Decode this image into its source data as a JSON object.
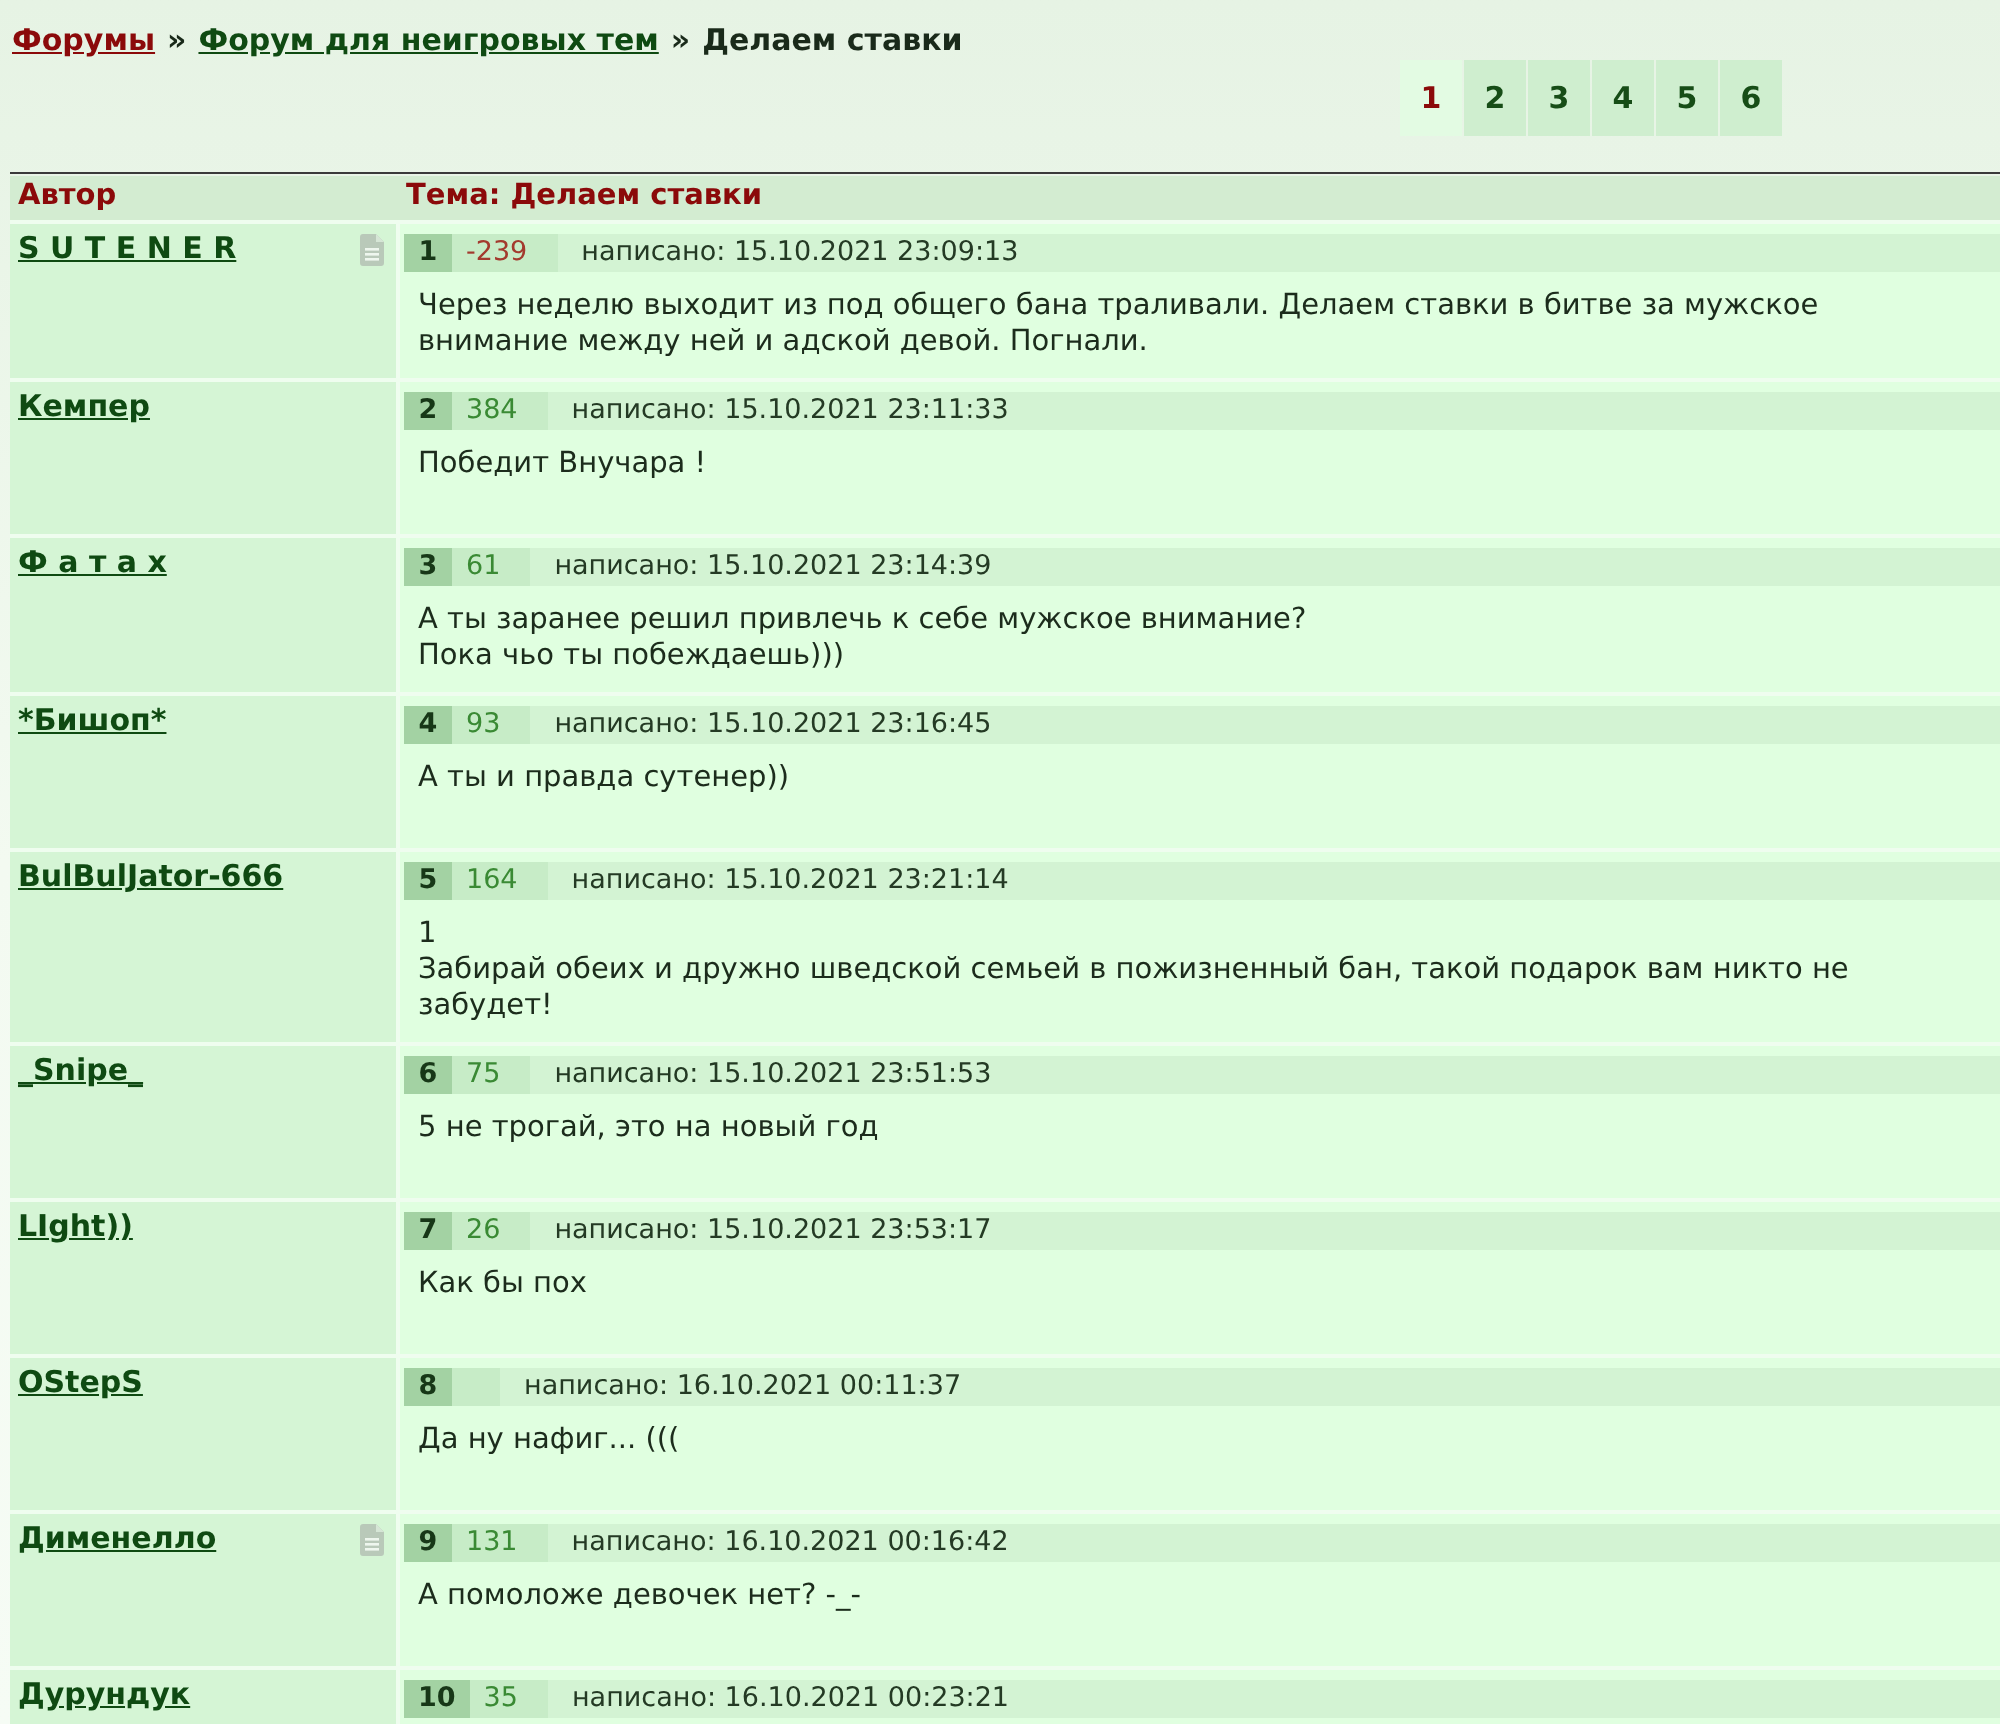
{
  "breadcrumb": [
    {
      "kind": "link",
      "label": "Форумы",
      "visited": true
    },
    {
      "kind": "separator",
      "label": "»"
    },
    {
      "kind": "link",
      "label": "Форум для неигровых тем",
      "visited": false
    },
    {
      "kind": "separator",
      "label": "»"
    },
    {
      "kind": "current",
      "label": "Делаем ставки"
    }
  ],
  "pagination": [
    {
      "label": "1",
      "selected": true
    },
    {
      "label": "2",
      "selected": false
    },
    {
      "label": "3",
      "selected": false
    },
    {
      "label": "4",
      "selected": false
    },
    {
      "label": "5",
      "selected": false
    },
    {
      "label": "6",
      "selected": false
    }
  ],
  "table": {
    "columns": [
      "Автор",
      "Тема: Делаем ставки"
    ],
    "posts": [
      {
        "author": "S U T E N E R",
        "file_icon": true,
        "number": "1",
        "rating": {
          "value": "-239",
          "color": "#a33a2e"
        },
        "date": "написано: 15.10.2021 23:09:13",
        "text": "Через неделю выходит из под общего бана траливали. Делаем ставки в битве за мужское внимание между ней и адской девой. Погнали."
      },
      {
        "author": "Кемпер",
        "file_icon": false,
        "number": "2",
        "rating": {
          "value": "384",
          "color": "#3a8a34"
        },
        "date": "написано: 15.10.2021 23:11:33",
        "text": "Победит Внучара !"
      },
      {
        "author": "Ф а т а х",
        "file_icon": false,
        "number": "3",
        "rating": {
          "value": "61",
          "color": "#3a8a34"
        },
        "date": "написано: 15.10.2021 23:14:39",
        "text": "А ты заранее решил привлечь к себе мужское внимание?\nПока чьо ты побеждаешь)))"
      },
      {
        "author": "*Бишоп*",
        "file_icon": false,
        "number": "4",
        "rating": {
          "value": "93",
          "color": "#3a8a34"
        },
        "date": "написано: 15.10.2021 23:16:45",
        "text": "А ты и правда сутенер))"
      },
      {
        "author": "BulBulJator-666",
        "file_icon": false,
        "number": "5",
        "rating": {
          "value": "164",
          "color": "#3a8a34"
        },
        "date": "написано: 15.10.2021 23:21:14",
        "text": "1\nЗабирай обеих и дружно шведской семьей в пожизненный бан, такой подарок вам никто не забудет!"
      },
      {
        "author": "_Snipe_",
        "file_icon": false,
        "number": "6",
        "rating": {
          "value": "75",
          "color": "#3a8a34"
        },
        "date": "написано: 15.10.2021 23:51:53",
        "text": "5 не трогай, это на новый год"
      },
      {
        "author": "LIght))",
        "file_icon": false,
        "number": "7",
        "rating": {
          "value": "26",
          "color": "#3a8a34"
        },
        "date": "написано: 15.10.2021 23:53:17",
        "text": "Как бы пох"
      },
      {
        "author": "OStepS",
        "file_icon": false,
        "number": "8",
        "date": "написано: 16.10.2021 00:11:37",
        "text": "Да ну нафиг... ((("
      },
      {
        "author": "Дименелло",
        "file_icon": true,
        "number": "9",
        "rating": {
          "value": "131",
          "color": "#3a8a34"
        },
        "date": "написано: 16.10.2021 00:16:42",
        "text": "А помоложе девочек нет? -_-"
      },
      {
        "author": "Дурундук",
        "file_icon": false,
        "number": "10",
        "rating": {
          "value": "35",
          "color": "#3a8a34"
        },
        "date": "написано: 16.10.2021 00:23:21"
      }
    ]
  }
}
